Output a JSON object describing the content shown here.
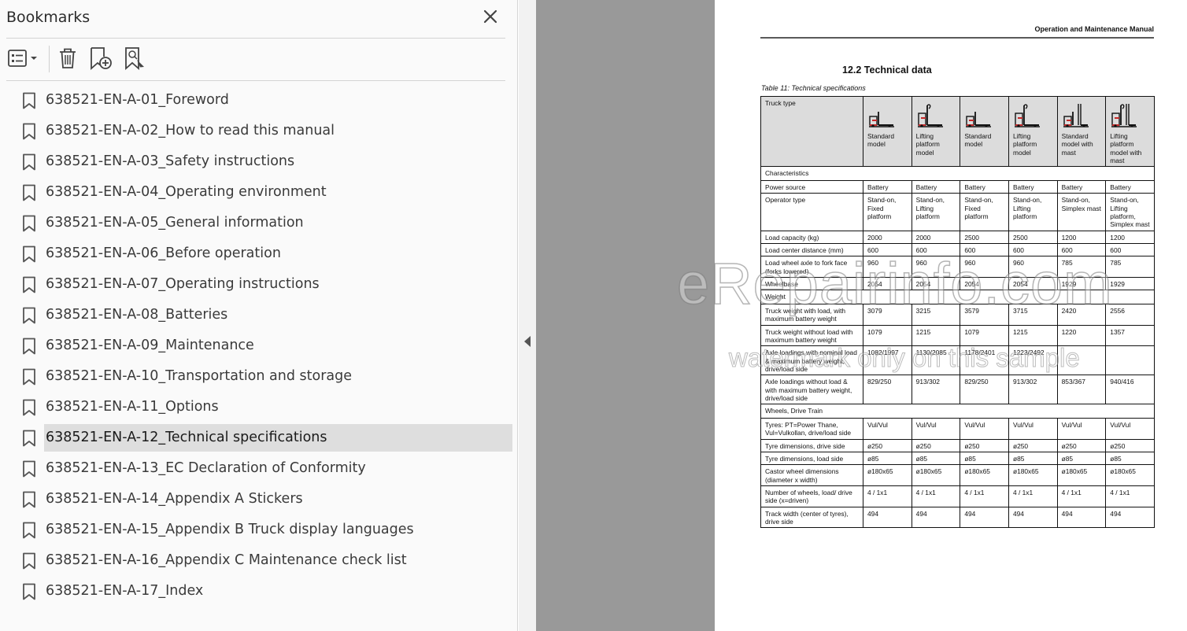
{
  "bookmarks_panel": {
    "title": "Bookmarks",
    "close_icon": "close-icon",
    "toolbar": [
      "options-menu-icon",
      "delete-bookmark-icon",
      "new-bookmark-icon",
      "find-current-bookmark-icon"
    ],
    "items": [
      {
        "label": "638521-EN-A-01_Foreword",
        "selected": false
      },
      {
        "label": "638521-EN-A-02_How to read this manual",
        "selected": false
      },
      {
        "label": "638521-EN-A-03_Safety instructions",
        "selected": false
      },
      {
        "label": "638521-EN-A-04_Operating environment",
        "selected": false
      },
      {
        "label": "638521-EN-A-05_General information",
        "selected": false
      },
      {
        "label": "638521-EN-A-06_Before operation",
        "selected": false
      },
      {
        "label": "638521-EN-A-07_Operating instructions",
        "selected": false
      },
      {
        "label": "638521-EN-A-08_Batteries",
        "selected": false
      },
      {
        "label": "638521-EN-A-09_Maintenance",
        "selected": false
      },
      {
        "label": "638521-EN-A-10_Transportation and storage",
        "selected": false
      },
      {
        "label": "638521-EN-A-11_Options",
        "selected": false
      },
      {
        "label": "638521-EN-A-12_Technical specifications",
        "selected": true
      },
      {
        "label": "638521-EN-A-13_EC Declaration of Conformity",
        "selected": false
      },
      {
        "label": "638521-EN-A-14_Appendix A Stickers",
        "selected": false
      },
      {
        "label": "638521-EN-A-15_Appendix B Truck display languages",
        "selected": false
      },
      {
        "label": "638521-EN-A-16_Appendix C Maintenance check list",
        "selected": false
      },
      {
        "label": "638521-EN-A-17_Index",
        "selected": false
      }
    ]
  },
  "document": {
    "header": "Operation and Maintenance Manual",
    "section_title": "12.2  Technical data",
    "table_caption": "Table 11:  Technical specifications",
    "table": {
      "truck_type_label": "Truck type",
      "models": [
        "Standard model",
        "Lifting platform model",
        "Standard model",
        "Lifting platform model",
        "Standard model with mast",
        "Lifting platform model with mast"
      ],
      "rows": [
        {
          "section": "Characteristics"
        },
        {
          "label": "Power source",
          "values": [
            "Battery",
            "Battery",
            "Battery",
            "Battery",
            "Battery",
            "Battery"
          ]
        },
        {
          "label": "Operator type",
          "values": [
            "Stand-on, Fixed platform",
            "Stand-on, Lifting platform",
            "Stand-on, Fixed platform",
            "Stand-on, Lifting platform",
            "Stand-on, Simplex mast",
            "Stand-on, Lifting platform, Simplex mast"
          ]
        },
        {
          "label": "Load capacity (kg)",
          "values": [
            "2000",
            "2000",
            "2500",
            "2500",
            "1200",
            "1200"
          ]
        },
        {
          "label": "Load center distance (mm)",
          "values": [
            "600",
            "600",
            "600",
            "600",
            "600",
            "600"
          ]
        },
        {
          "label": "Load wheel axle to fork face (forks lowered)",
          "values": [
            "960",
            "960",
            "960",
            "960",
            "785",
            "785"
          ]
        },
        {
          "label": "Wheelbase",
          "values": [
            "2054",
            "2054",
            "2054",
            "2054",
            "1929",
            "1929"
          ]
        },
        {
          "section": "Weight"
        },
        {
          "label": "Truck weight with load, with maximum battery weight",
          "values": [
            "3079",
            "3215",
            "3579",
            "3715",
            "2420",
            "2556"
          ]
        },
        {
          "label": "Truck weight without load with maximum battery weight",
          "values": [
            "1079",
            "1215",
            "1079",
            "1215",
            "1220",
            "1357"
          ]
        },
        {
          "label": "Axle loadings with nominal load & maximum battery weight, drive/load side",
          "values": [
            "1082/1997",
            "1130/2085",
            "1178/2401",
            "1223/2492",
            "",
            ""
          ]
        },
        {
          "label": "Axle loadings without load & with maximum battery weight, drive/load side",
          "values": [
            "829/250",
            "913/302",
            "829/250",
            "913/302",
            "853/367",
            "940/416"
          ]
        },
        {
          "section": "Wheels, Drive Train"
        },
        {
          "label": "Tyres: PT=Power Thane, Vul=Vulkollan, drive/load side",
          "values": [
            "Vul/Vul",
            "Vul/Vul",
            "Vul/Vul",
            "Vul/Vul",
            "Vul/Vul",
            "Vul/Vul"
          ]
        },
        {
          "label": "Tyre dimensions, drive side",
          "values": [
            "ø250",
            "ø250",
            "ø250",
            "ø250",
            "ø250",
            "ø250"
          ]
        },
        {
          "label": "Tyre dimensions, load side",
          "values": [
            "ø85",
            "ø85",
            "ø85",
            "ø85",
            "ø85",
            "ø85"
          ]
        },
        {
          "label": "Castor wheel dimensions (diameter x width)",
          "values": [
            "ø180x65",
            "ø180x65",
            "ø180x65",
            "ø180x65",
            "ø180x65",
            "ø180x65"
          ]
        },
        {
          "label": "Number of wheels, load/ drive side  (x=driven)",
          "values": [
            "4 / 1x1",
            "4 / 1x1",
            "4 / 1x1",
            "4 / 1x1",
            "4 / 1x1",
            "4 / 1x1"
          ]
        },
        {
          "label": "Track width (center of tyres), drive side",
          "values": [
            "494",
            "494",
            "494",
            "494",
            "494",
            "494"
          ]
        }
      ]
    }
  },
  "watermark": {
    "main": "eRepairinfo.com",
    "sub": "watermark only on this sample"
  }
}
